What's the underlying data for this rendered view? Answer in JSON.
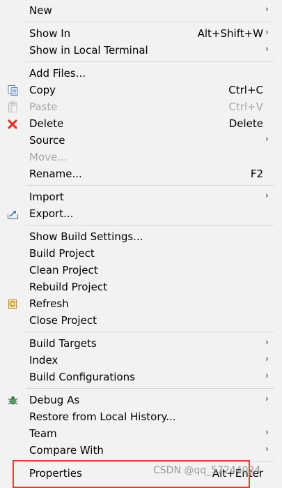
{
  "menu": {
    "new": {
      "label": "New"
    },
    "show_in": {
      "label": "Show In",
      "shortcut": "Alt+Shift+W"
    },
    "show_local_terminal": {
      "label": "Show in Local Terminal"
    },
    "add_files": {
      "label": "Add Files..."
    },
    "copy": {
      "label": "Copy",
      "shortcut": "Ctrl+C",
      "icon": "copy-icon"
    },
    "paste": {
      "label": "Paste",
      "shortcut": "Ctrl+V",
      "icon": "paste-icon",
      "enabled": false
    },
    "delete": {
      "label": "Delete",
      "shortcut": "Delete",
      "icon": "delete-icon"
    },
    "source": {
      "label": "Source"
    },
    "move": {
      "label": "Move...",
      "enabled": false
    },
    "rename": {
      "label": "Rename...",
      "shortcut": "F2"
    },
    "import": {
      "label": "Import"
    },
    "export": {
      "label": "Export...",
      "icon": "export-icon"
    },
    "show_build_settings": {
      "label": "Show Build Settings..."
    },
    "build_project": {
      "label": "Build Project"
    },
    "clean_project": {
      "label": "Clean Project"
    },
    "rebuild_project": {
      "label": "Rebuild Project"
    },
    "refresh": {
      "label": "Refresh",
      "icon": "refresh-icon"
    },
    "close_project": {
      "label": "Close Project"
    },
    "build_targets": {
      "label": "Build Targets"
    },
    "index": {
      "label": "Index"
    },
    "build_configurations": {
      "label": "Build Configurations"
    },
    "debug_as": {
      "label": "Debug As",
      "icon": "bug-icon"
    },
    "restore_local_history": {
      "label": "Restore from Local History..."
    },
    "team": {
      "label": "Team"
    },
    "compare_with": {
      "label": "Compare With"
    },
    "properties": {
      "label": "Properties",
      "shortcut": "Alt+Enter"
    }
  },
  "submenu_arrow": "›",
  "watermark": "CSDN @qq_57244024",
  "colors": {
    "menu_background": "#f2f2f2",
    "separator": "#d7d7d7",
    "disabled_text": "#a7a7a7",
    "highlight_border": "#e0403a",
    "delete_icon": "#d9362b"
  }
}
